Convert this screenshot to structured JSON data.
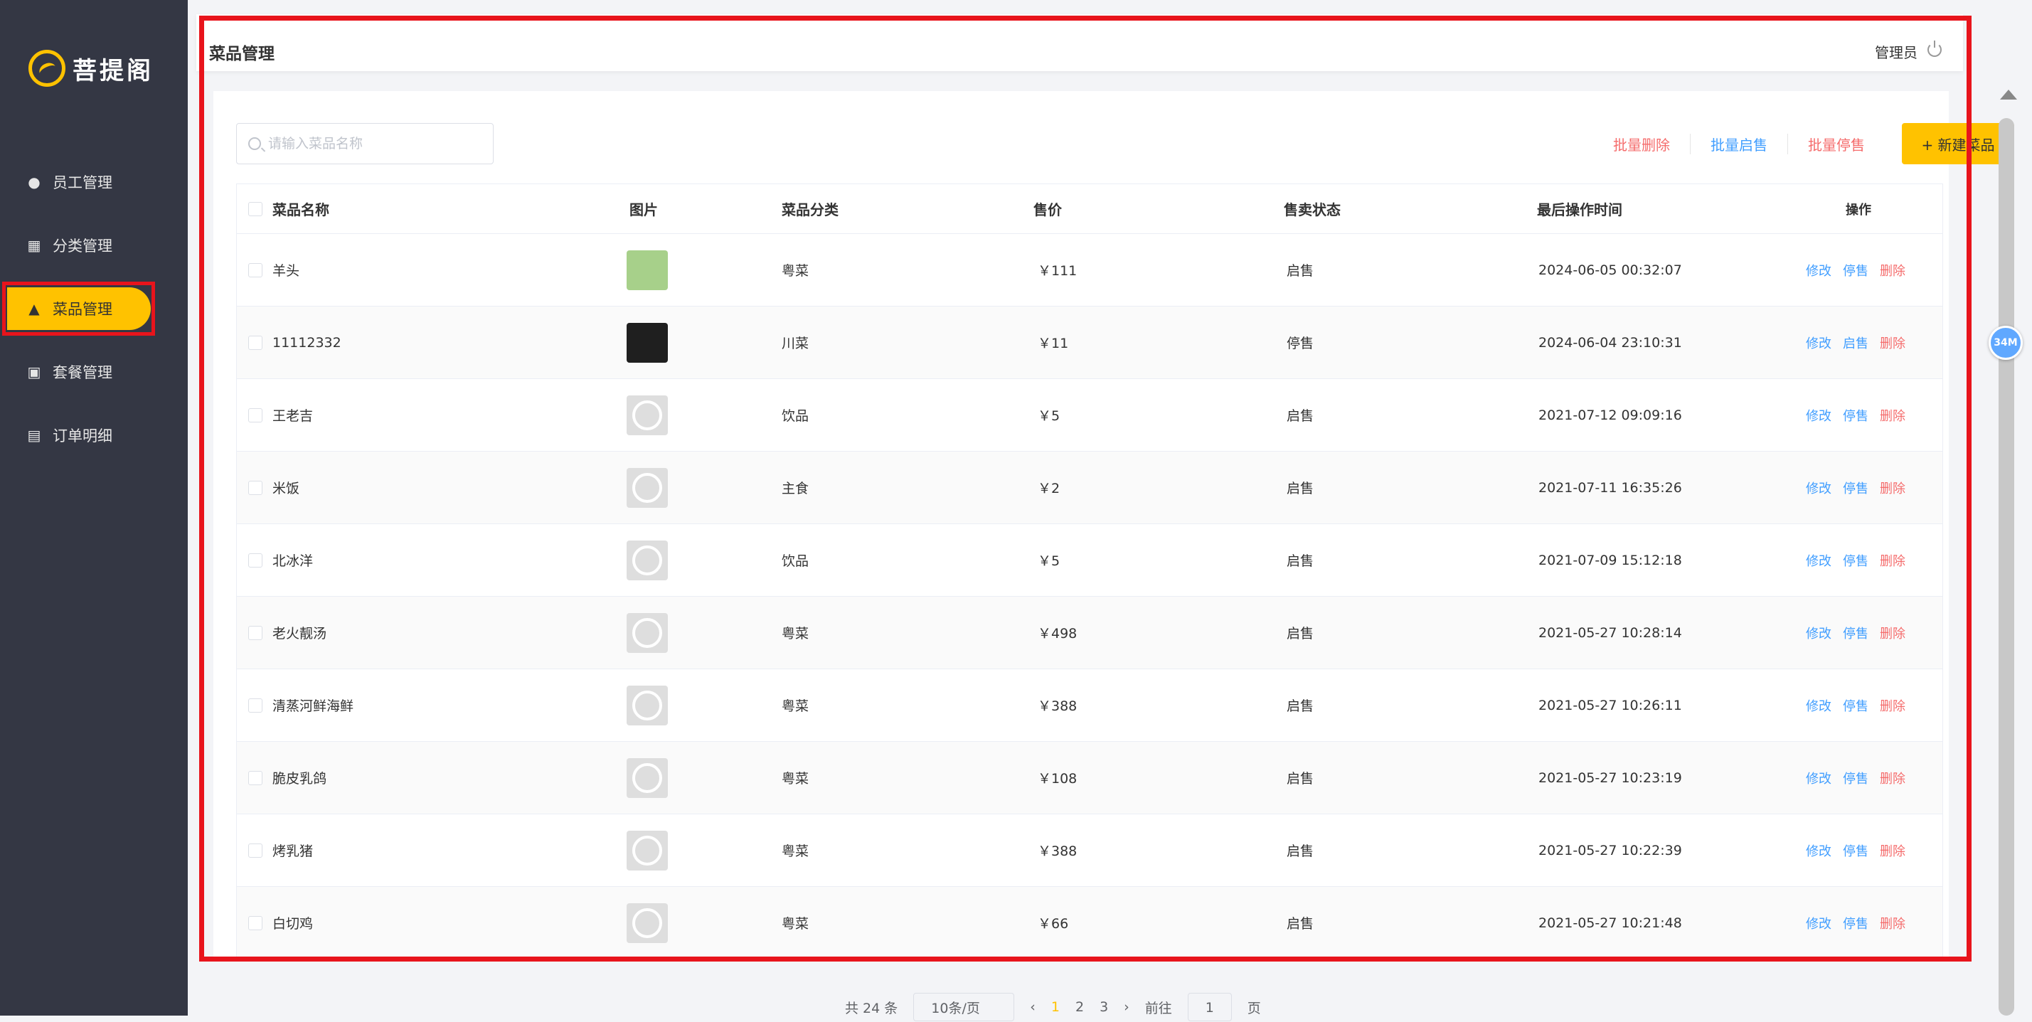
{
  "app": {
    "logo_text": "菩提阁"
  },
  "sidebar": {
    "items": [
      {
        "label": "员工管理",
        "icon": "info-icon"
      },
      {
        "label": "分类管理",
        "icon": "grid-icon"
      },
      {
        "label": "菜品管理",
        "icon": "bell-icon",
        "active": true
      },
      {
        "label": "套餐管理",
        "icon": "gift-icon"
      },
      {
        "label": "订单明细",
        "icon": "clipboard-icon"
      }
    ]
  },
  "header": {
    "title": "菜品管理",
    "user": "管理员"
  },
  "toolbar": {
    "search_placeholder": "请输入菜品名称",
    "batch_delete": "批量删除",
    "batch_enable": "批量启售",
    "batch_disable": "批量停售",
    "new_button": "+ 新建菜品"
  },
  "table": {
    "columns": [
      "菜品名称",
      "图片",
      "菜品分类",
      "售价",
      "售卖状态",
      "最后操作时间",
      "操作"
    ],
    "rows": [
      {
        "name": "羊头",
        "category": "粤菜",
        "price": "￥111",
        "status": "启售",
        "time": "2024-06-05 00:32:07",
        "op_edit": "修改",
        "op_toggle": "停售",
        "op_delete": "删除"
      },
      {
        "name": "11112332",
        "category": "川菜",
        "price": "￥11",
        "status": "停售",
        "time": "2024-06-04 23:10:31",
        "op_edit": "修改",
        "op_toggle": "启售",
        "op_delete": "删除"
      },
      {
        "name": "王老吉",
        "category": "饮品",
        "price": "￥5",
        "status": "启售",
        "time": "2021-07-12 09:09:16",
        "op_edit": "修改",
        "op_toggle": "停售",
        "op_delete": "删除"
      },
      {
        "name": "米饭",
        "category": "主食",
        "price": "￥2",
        "status": "启售",
        "time": "2021-07-11 16:35:26",
        "op_edit": "修改",
        "op_toggle": "停售",
        "op_delete": "删除"
      },
      {
        "name": "北冰洋",
        "category": "饮品",
        "price": "￥5",
        "status": "启售",
        "time": "2021-07-09 15:12:18",
        "op_edit": "修改",
        "op_toggle": "停售",
        "op_delete": "删除"
      },
      {
        "name": "老火靓汤",
        "category": "粤菜",
        "price": "￥498",
        "status": "启售",
        "time": "2021-05-27 10:28:14",
        "op_edit": "修改",
        "op_toggle": "停售",
        "op_delete": "删除"
      },
      {
        "name": "清蒸河鲜海鲜",
        "category": "粤菜",
        "price": "￥388",
        "status": "启售",
        "time": "2021-05-27 10:26:11",
        "op_edit": "修改",
        "op_toggle": "停售",
        "op_delete": "删除"
      },
      {
        "name": "脆皮乳鸽",
        "category": "粤菜",
        "price": "￥108",
        "status": "启售",
        "time": "2021-05-27 10:23:19",
        "op_edit": "修改",
        "op_toggle": "停售",
        "op_delete": "删除"
      },
      {
        "name": "烤乳猪",
        "category": "粤菜",
        "price": "￥388",
        "status": "启售",
        "time": "2021-05-27 10:22:39",
        "op_edit": "修改",
        "op_toggle": "停售",
        "op_delete": "删除"
      },
      {
        "name": "白切鸡",
        "category": "粤菜",
        "price": "￥66",
        "status": "启售",
        "time": "2021-05-27 10:21:48",
        "op_edit": "修改",
        "op_toggle": "停售",
        "op_delete": "删除"
      }
    ]
  },
  "pagination": {
    "total": "共 24 条",
    "page_size": "10条/页",
    "pages": [
      "1",
      "2",
      "3"
    ],
    "current": "1",
    "goto_label": "前往",
    "goto_value": "1",
    "page_unit": "页"
  },
  "badge": {
    "text": "34M"
  },
  "colors": {
    "accent": "#ffc200",
    "sidebar": "#343744",
    "link": "#419eff",
    "danger": "#f56c6c",
    "highlight": "#e8141c"
  }
}
